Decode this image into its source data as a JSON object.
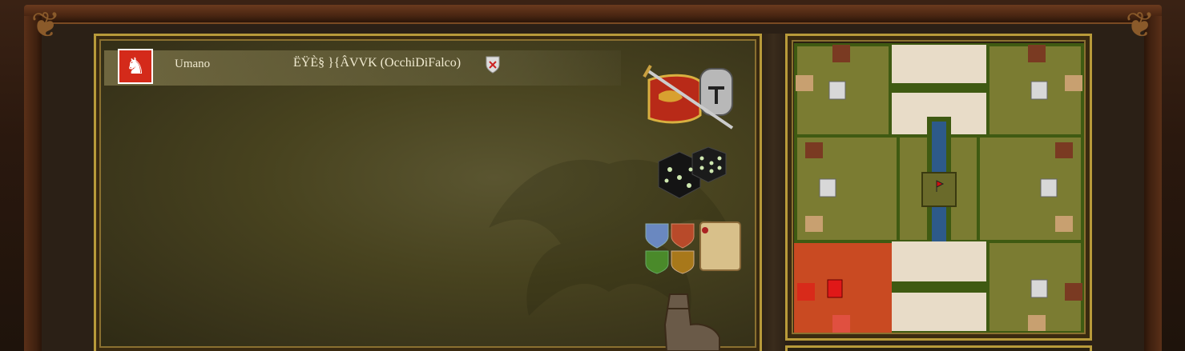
{
  "player": {
    "type": "Umano",
    "name": "ËŸÈ§ }{ÂVVK (OcchiDiFalco)"
  },
  "side_icons": [
    "sword-shield-helmet-icon",
    "dice-icon",
    "heraldry-scroll-icon",
    "boot-icon"
  ],
  "map": {
    "colors": {
      "grass": "#7b7c32",
      "dark_grass": "#3f5a12",
      "sand": "#e8dcc8",
      "water": "#2d5a8a",
      "player_red": "#c94a22",
      "plot": "#7a3a22",
      "light_plot": "#c8a070"
    }
  }
}
